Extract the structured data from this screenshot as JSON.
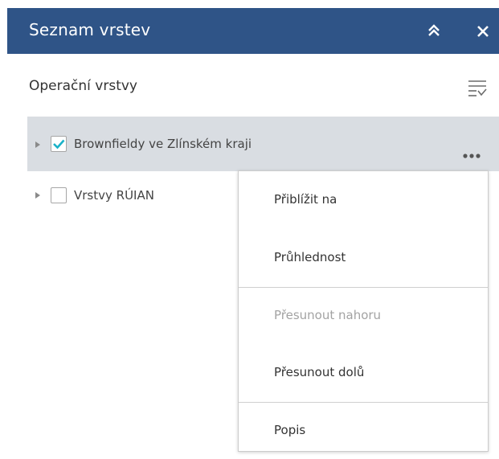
{
  "panel": {
    "title": "Seznam vrstev",
    "header_color": "#2f5487",
    "collapse_icon": "double-chevron-up-icon",
    "close_icon": "close-icon"
  },
  "section": {
    "title": "Operační vrstvy",
    "filter_icon": "filter-list-icon"
  },
  "layers": [
    {
      "label": "Brownfieldy ve Zlínském kraji",
      "checked": true,
      "selected": true,
      "check_color": "#1ab2c8"
    },
    {
      "label": "Vrstvy RÚIAN",
      "checked": false,
      "selected": false
    }
  ],
  "context_menu": {
    "items": [
      {
        "label": "Přiblížit na",
        "enabled": true
      },
      {
        "label": "Průhlednost",
        "enabled": true
      },
      {
        "label": "Přesunout nahoru",
        "enabled": false
      },
      {
        "label": "Přesunout dolů",
        "enabled": true
      },
      {
        "label": "Popis",
        "enabled": true
      }
    ]
  }
}
